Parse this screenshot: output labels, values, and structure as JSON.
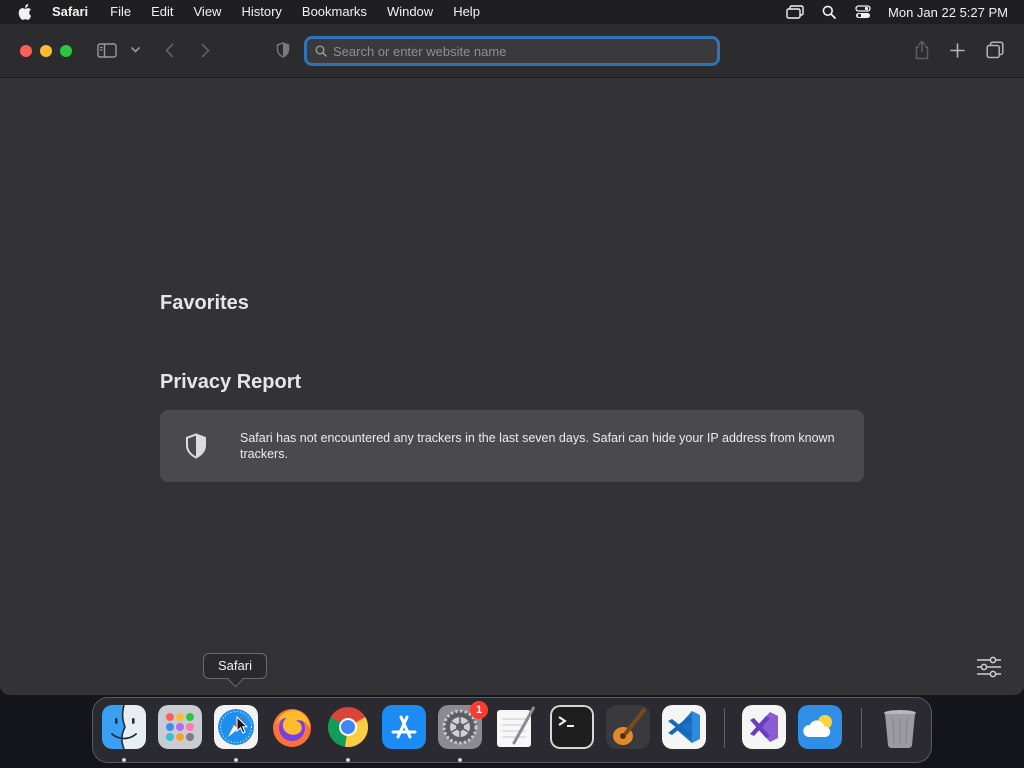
{
  "menubar": {
    "app_name": "Safari",
    "items": [
      "File",
      "Edit",
      "View",
      "History",
      "Bookmarks",
      "Window",
      "Help"
    ],
    "clock": "Mon Jan 22  5:27 PM"
  },
  "toolbar": {
    "address_placeholder": "Search or enter website name",
    "address_value": ""
  },
  "content": {
    "favorites_title": "Favorites",
    "privacy_title": "Privacy Report",
    "privacy_text": "Safari has not encountered any trackers in the last seven days. Safari can hide your IP address from known trackers."
  },
  "dock": {
    "tooltip": "Safari",
    "apps": [
      {
        "name": "Finder",
        "icon": "finder-icon",
        "running": true
      },
      {
        "name": "Launchpad",
        "icon": "launchpad-icon",
        "running": false
      },
      {
        "name": "Safari",
        "icon": "safari-icon",
        "running": true
      },
      {
        "name": "Firefox",
        "icon": "firefox-icon",
        "running": false
      },
      {
        "name": "Google Chrome",
        "icon": "chrome-icon",
        "running": true
      },
      {
        "name": "App Store",
        "icon": "app-store-icon",
        "running": false
      },
      {
        "name": "System Settings",
        "icon": "system-settings-icon",
        "running": true,
        "badge": "1"
      },
      {
        "name": "TextEdit",
        "icon": "textedit-icon",
        "running": false
      },
      {
        "name": "Terminal",
        "icon": "terminal-icon",
        "running": false
      },
      {
        "name": "GarageBand",
        "icon": "garageband-icon",
        "running": false
      },
      {
        "name": "Visual Studio Code",
        "icon": "vscode-icon",
        "running": false
      },
      {
        "name": "Visual Studio",
        "icon": "visual-studio-icon",
        "running": false
      },
      {
        "name": "Weather",
        "icon": "weather-icon",
        "running": false
      },
      {
        "name": "Trash",
        "icon": "trash-icon",
        "running": false
      }
    ]
  },
  "colors": {
    "accent": "#2f73b8",
    "window_bg": "#333336",
    "card_bg": "#4a4a4c",
    "badge": "#ff3b30"
  }
}
